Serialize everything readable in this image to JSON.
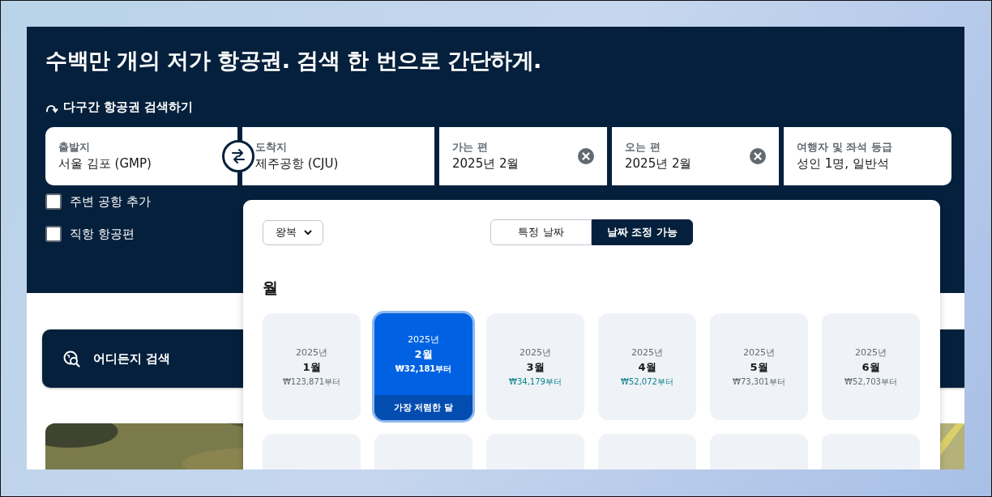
{
  "headline": "수백만 개의 저가 항공권. 검색 한 번으로 간단하게.",
  "multi_city_link": "다구간 항공권 검색하기",
  "fields": [
    {
      "label": "출발지",
      "value": "서울 김포 (GMP)",
      "clearable": false
    },
    {
      "label": "도착지",
      "value": "제주공항 (CJU)",
      "clearable": false
    },
    {
      "label": "가는 편",
      "value": "2025년 2월",
      "clearable": true
    },
    {
      "label": "오는 편",
      "value": "2025년 2월",
      "clearable": true
    },
    {
      "label": "여행자 및 좌석 등급",
      "value": "성인 1명, 일반석",
      "clearable": false
    }
  ],
  "options": [
    {
      "label": "주변 공항 추가",
      "checked": false
    },
    {
      "label": "직항 항공편",
      "checked": false
    }
  ],
  "explore_button": {
    "label": "어디든지 검색"
  },
  "date_popup": {
    "trip_type": "왕복",
    "modes": [
      {
        "label": "특정 날짜",
        "selected": false
      },
      {
        "label": "날짜 조정 가능",
        "selected": true
      }
    ],
    "section_title": "월",
    "months": [
      {
        "kind": "month",
        "year": "2025년",
        "month": "1월",
        "price": "₩123,871부터",
        "color": "#626971",
        "selected": false
      },
      {
        "kind": "month",
        "year": "2025년",
        "month": "2월",
        "price": "₩32,181부터",
        "color": "#ffffff",
        "selected": true,
        "badge": "가장 저렴한 달"
      },
      {
        "kind": "month",
        "year": "2025년",
        "month": "3월",
        "price": "₩34,179부터",
        "color": "#0c838a",
        "selected": false
      },
      {
        "kind": "month",
        "year": "2025년",
        "month": "4월",
        "price": "₩52,072부터",
        "color": "#0c838a",
        "selected": false
      },
      {
        "kind": "month",
        "year": "2025년",
        "month": "5월",
        "price": "₩73,301부터",
        "color": "#626971",
        "selected": false
      },
      {
        "kind": "month",
        "year": "2025년",
        "month": "6월",
        "price": "₩52,703부터",
        "color": "#626971",
        "selected": false
      },
      {
        "kind": "blank"
      },
      {
        "kind": "blank"
      },
      {
        "kind": "blank"
      },
      {
        "kind": "blank"
      },
      {
        "kind": "blank"
      },
      {
        "kind": "blank"
      }
    ]
  }
}
